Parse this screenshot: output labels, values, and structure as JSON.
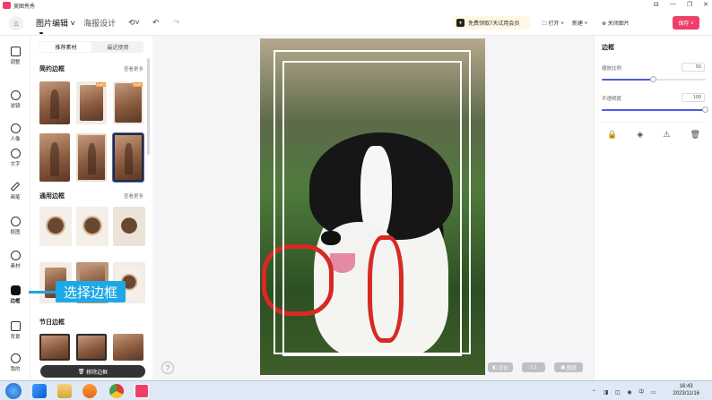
{
  "app": {
    "name": "美图秀秀",
    "window_buttons": [
      "⊟",
      "—",
      "❐",
      "✕"
    ]
  },
  "toolbar": {
    "tabs": [
      {
        "label": "图片编辑 ˅",
        "active": true
      },
      {
        "label": "海报设计",
        "active": false
      }
    ],
    "history_icon": "⟲˅",
    "undo_icon": "↶",
    "redo_icon": "↷",
    "promo": "免费领取7天试用会员",
    "open_label": "打开 ˅",
    "new_label": "新建 ˅",
    "close_image_label": "关闭图片",
    "save_label": "保存 ˅"
  },
  "rail": [
    {
      "label": "调整",
      "icon": "sliders-icon"
    },
    {
      "label": "滤镜",
      "icon": "filter-icon"
    },
    {
      "label": "人像",
      "icon": "portrait-icon"
    },
    {
      "label": "文字",
      "icon": "text-icon"
    },
    {
      "label": "画笔",
      "icon": "brush-icon"
    },
    {
      "label": "抠图",
      "icon": "cutout-icon"
    },
    {
      "label": "素材",
      "icon": "sticker-icon"
    },
    {
      "label": "边框",
      "icon": "frame-icon",
      "active": true
    },
    {
      "label": "背景",
      "icon": "background-icon"
    },
    {
      "label": "我的",
      "icon": "user-icon"
    }
  ],
  "panel": {
    "segments": [
      "推荐素材",
      "最近使用"
    ],
    "sections": [
      {
        "title": "简约边框",
        "more": "查看更多"
      },
      {
        "title": "通用边框",
        "more": "查看更多"
      },
      {
        "title": "节日边框",
        "more": ""
      }
    ],
    "svip_badge": "SVIP",
    "remove_label": "移除边框"
  },
  "callout": "选择边框",
  "canvas": {
    "compare_label": "对比",
    "zoom_label": "1:1",
    "preview_label": "图层",
    "help_icon": "?"
  },
  "props": {
    "title": "边框",
    "scale_label": "缩放比例",
    "scale_value": "50",
    "scale_fraction": 0.5,
    "opacity_label": "不透明度",
    "opacity_value": "100",
    "opacity_fraction": 1.0,
    "tools": [
      "🔒",
      "◈",
      "⚠",
      "🗑"
    ]
  },
  "taskbar": {
    "tray": "⌃ ◨ ◫ ◉ 中 ▭",
    "time": "16:43",
    "date": "2023/11/16"
  },
  "colors": {
    "accent": "#ef3e6a",
    "slider": "#4a5de0",
    "callout": "#1ea9e6"
  }
}
